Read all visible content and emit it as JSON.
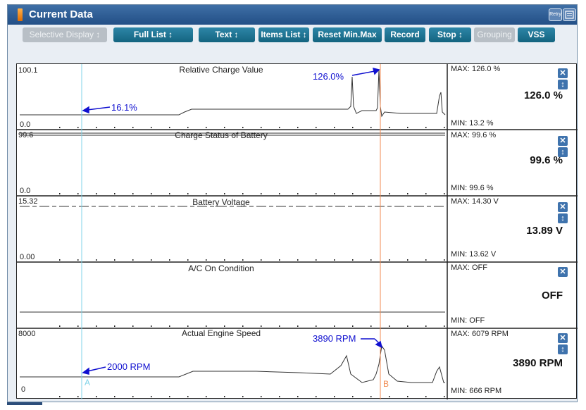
{
  "window": {
    "title": "Current Data",
    "retry_icon": "retry-icon",
    "menu_icon": "menu-icon",
    "retry_label": "Retry"
  },
  "toolbar": {
    "selective_display": "Selective Display ↕",
    "full_list": "Full List ↕",
    "text": "Text ↕",
    "items_list": "Items List ↕",
    "reset_min_max": "Reset Min.Max",
    "record": "Record",
    "stop": "Stop ↕",
    "grouping": "Grouping",
    "vss": "VSS"
  },
  "graphs": [
    {
      "name": "Relative Charge Value",
      "ymax": "100.1",
      "ymin": "0.0",
      "max": "MAX: 126.0 %",
      "current": "126.0 %",
      "min": "MIN: 13.2 %",
      "annotations": [
        "16.1%",
        "126.0%"
      ]
    },
    {
      "name": "Charge Status of Battery",
      "ymax": "99.6",
      "ymin": "0.0",
      "max": "MAX: 99.6 %",
      "current": "99.6 %",
      "min": "MIN: 99.6 %"
    },
    {
      "name": "Battery Voltage",
      "ymax": "15.32",
      "ymin": "0.00",
      "max": "MAX: 14.30 V",
      "current": "13.89 V",
      "min": "MIN: 13.62 V"
    },
    {
      "name": "A/C On Condition",
      "ymax": "",
      "ymin": "",
      "max": "MAX: OFF",
      "current": "OFF",
      "min": "MIN: OFF"
    },
    {
      "name": "Actual Engine Speed",
      "ymax": "8000",
      "ymin": "0",
      "max": "MAX:  6079 RPM",
      "current": "3890 RPM",
      "min": "MIN:   666 RPM",
      "annotations": [
        "2000 RPM",
        "3890 RPM"
      ]
    }
  ],
  "cursors": {
    "a": "A",
    "b": "B"
  },
  "controls": {
    "close": "✕",
    "move": "↕"
  },
  "colors": {
    "title_bar": "#234f86",
    "button": "#1f7896",
    "annot": "#1010d0",
    "cursor_a": "#7fd3e8",
    "cursor_b": "#f08a50"
  }
}
